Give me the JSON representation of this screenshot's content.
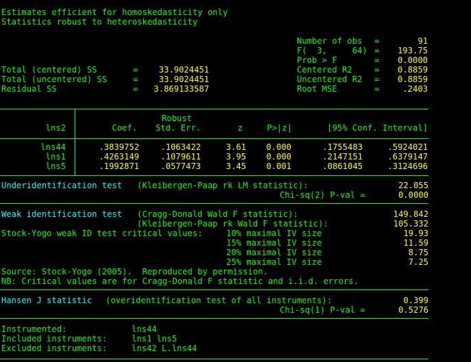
{
  "header": {
    "line1": "Estimates efficient for homoskedasticity only",
    "line2": "Statistics robust to heteroskedasticity"
  },
  "stats_left": [
    {
      "label": "Total (centered) SS",
      "eq": "=",
      "value": "33.9024451"
    },
    {
      "label": "Total (uncentered) SS",
      "eq": "=",
      "value": "33.9024451"
    },
    {
      "label": "Residual SS",
      "eq": "=",
      "value": "3.869133587"
    }
  ],
  "stats_right": [
    {
      "label": "Number of obs",
      "eq": "=",
      "value": "91"
    },
    {
      "label": "F(  3,     64)",
      "eq": "=",
      "value": "193.75"
    },
    {
      "label": "Prob > F",
      "eq": "=",
      "value": "0.0000"
    },
    {
      "label": "Centered R2",
      "eq": "=",
      "value": "0.8859"
    },
    {
      "label": "Uncentered R2",
      "eq": "=",
      "value": "0.8859"
    },
    {
      "label": "Root MSE",
      "eq": "=",
      "value": ".2403"
    }
  ],
  "table": {
    "depvar": "lns2",
    "robust_label": "Robust",
    "columns": [
      "Coef.",
      "Std. Err.",
      "z",
      "P>|z|",
      "[95% Conf. Interval]"
    ],
    "rows": [
      {
        "var": "lns44",
        "coef": ".3839752",
        "se": ".1063422",
        "z": "3.61",
        "p": "0.000",
        "lo": ".1755483",
        "hi": ".5924021"
      },
      {
        "var": "lns1",
        "coef": ".4263149",
        "se": ".1079611",
        "z": "3.95",
        "p": "0.000",
        "lo": ".2147151",
        "hi": ".6379147"
      },
      {
        "var": "lns5",
        "coef": ".1992871",
        "se": ".0577473",
        "z": "3.45",
        "p": "0.001",
        "lo": ".0861045",
        "hi": ".3124696"
      }
    ]
  },
  "underid": {
    "title": "Underidentification test",
    "desc": "(Kleibergen-Paap rk LM statistic):",
    "value": "22.055",
    "pval_label": "Chi-sq(2) P-val =",
    "pval": "0.0000"
  },
  "weakid": {
    "title": "Weak identification test",
    "desc1": "(Cragg-Donald Wald F statistic):",
    "value1": "149.842",
    "desc2": "(Kleibergen-Paap rk Wald F statistic):",
    "value2": "105.332",
    "sy_label": "Stock-Yogo weak ID test critical values:",
    "sy_rows": [
      {
        "label": "10% maximal IV size",
        "value": "19.93"
      },
      {
        "label": "15% maximal IV size",
        "value": "11.59"
      },
      {
        "label": "20% maximal IV size",
        "value": "8.75"
      },
      {
        "label": "25% maximal IV size",
        "value": "7.25"
      }
    ],
    "source": "Source: Stock-Yogo (2005).  Reproduced by permission.",
    "nb": "NB: Critical values are for Cragg-Donald F statistic and i.i.d. errors."
  },
  "hansen": {
    "title": "Hansen J statistic",
    "desc": "(overidentification test of all instruments):",
    "value": "0.399",
    "pval_label": "Chi-sq(1) P-val =",
    "pval": "0.5276"
  },
  "instruments": {
    "instrumented_label": "Instrumented:",
    "instrumented": "lns44",
    "included_label": "Included instruments:",
    "included": "lns1 lns5",
    "excluded_label": "Excluded instruments:",
    "excluded": "lns42 L.lns44"
  },
  "colors": {
    "background": "#000000",
    "text": "#00ff00",
    "result": "#ffff00",
    "heading": "#00ffff"
  }
}
